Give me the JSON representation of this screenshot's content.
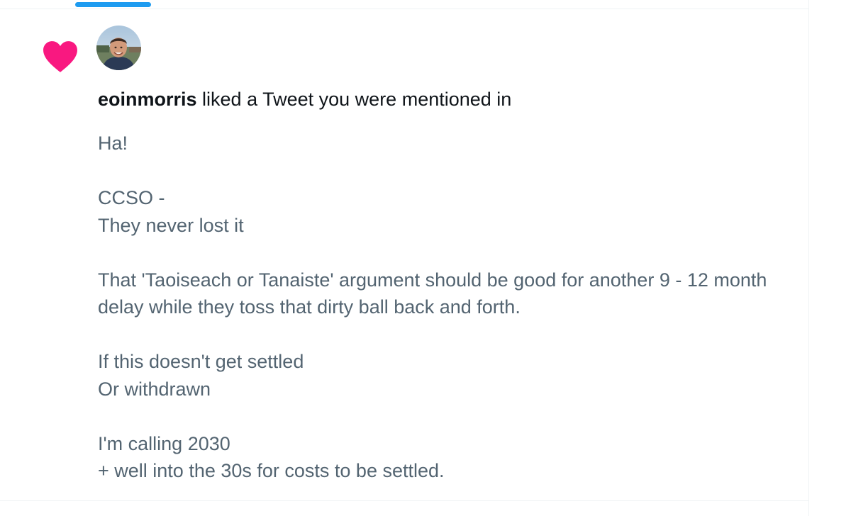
{
  "notification": {
    "user_name": "eoinmorris",
    "action_text": " liked a Tweet you were mentioned in",
    "tweet_text": "Ha!\n\nCCSO -\nThey never lost it\n\nThat 'Taoiseach or Tanaiste' argument should be good for another 9 - 12 month delay while they toss that dirty ball back and forth.\n\nIf this doesn't get settled\nOr withdrawn\n\nI'm calling 2030\n+ well into the 30s for costs to be settled."
  },
  "colors": {
    "like": "#f91880",
    "accent": "#1d9bf0",
    "text_primary": "#0f1419",
    "text_secondary": "#536471",
    "divider": "#eff3f4"
  },
  "icons": {
    "like": "heart-icon",
    "avatar": "user-avatar"
  }
}
